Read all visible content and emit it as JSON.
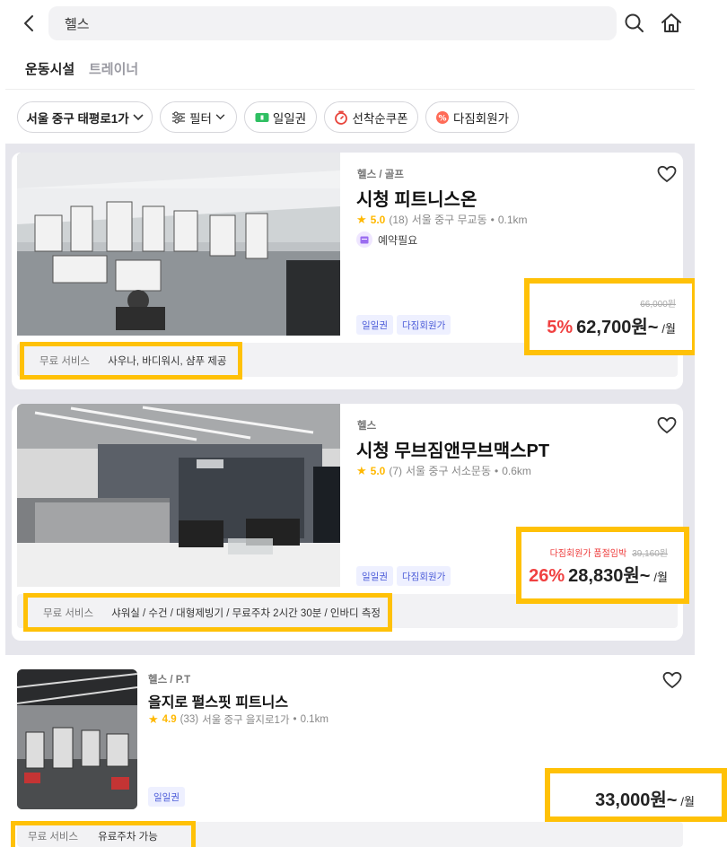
{
  "search": {
    "query": "헬스"
  },
  "tabs": [
    {
      "label": "운동시설"
    },
    {
      "label": "트레이너"
    }
  ],
  "filters": {
    "location": "서울 중구 태평로1가",
    "filter": "필터",
    "day_pass": "일일권",
    "first_come_coupon": "선착순쿠폰",
    "multi_pass": "다짐회원가"
  },
  "listings": [
    {
      "category": "헬스 / 골프",
      "name": "시청 피트니스온",
      "rating": "5.0",
      "reviews": "(18)",
      "location": "서울 중구 무교동",
      "distance": "0.1km",
      "reservation": "예약필요",
      "tags": [
        "일일권",
        "다짐회원가"
      ],
      "original_price": "66,000원",
      "discount": "5%",
      "price": "62,700원~",
      "per": "/월",
      "service_label": "무료 서비스",
      "service_text": "사우나, 바디워시, 샴푸 제공"
    },
    {
      "category": "헬스",
      "name": "시청 무브짐앤무브맥스PT",
      "rating": "5.0",
      "reviews": "(7)",
      "location": "서울 중구 서소문동",
      "distance": "0.6km",
      "tags": [
        "일일권",
        "다짐회원가"
      ],
      "sold_out_notice": "다짐회원가 품절임박",
      "original_price": "39,160원",
      "discount": "26%",
      "price": "28,830원~",
      "per": "/월",
      "service_label": "무료 서비스",
      "service_text": "샤워실 / 수건 / 대형제빙기 /  무료주차 2시간 30분 / 인바디 측정"
    },
    {
      "category": "헬스 / P.T",
      "name": "을지로 펄스핏 피트니스",
      "rating": "4.9",
      "reviews": "(33)",
      "location": "서울 중구 을지로1가",
      "distance": "0.1km",
      "tags": [
        "일일권"
      ],
      "price": "33,000원~",
      "per": "/월",
      "service_label": "무료 서비스",
      "service_text": "유료주차 가능"
    }
  ],
  "colors": {
    "highlight": "#ffc107",
    "discount": "#f04141",
    "star": "#ffb800",
    "tag_bg": "#eef0ff",
    "tag_text": "#4b5bd8",
    "list_bg": "#e6e6ec"
  }
}
